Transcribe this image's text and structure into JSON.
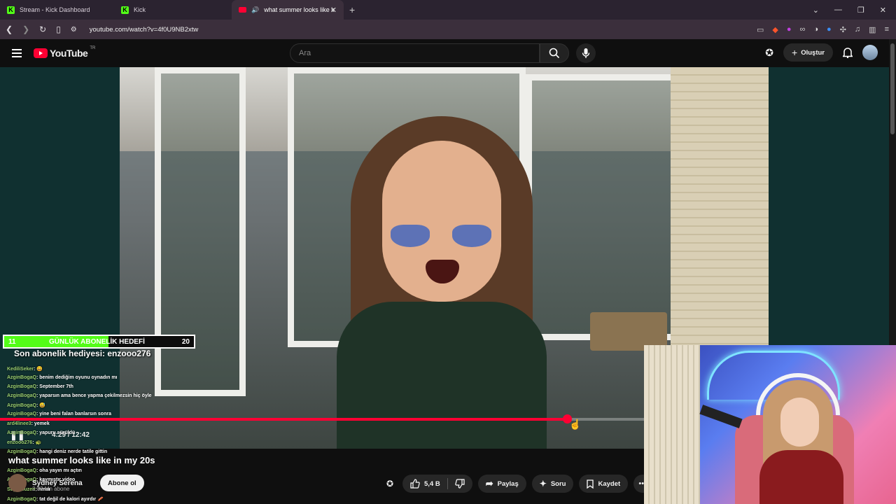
{
  "browser": {
    "tabs": [
      {
        "title": "Stream - Kick Dashboard",
        "icon": "kick-icon",
        "active": false
      },
      {
        "title": "Kick",
        "icon": "kick-icon",
        "active": false
      },
      {
        "title": "what summer looks like in my",
        "icon": "youtube-icon",
        "active": true
      }
    ],
    "new_tab": "+",
    "url": "youtube.com/watch?v=4f0U9NB2xtw",
    "window_controls": [
      "⌄",
      "—",
      "❐",
      "✕"
    ]
  },
  "youtube": {
    "logo_text": "YouTube",
    "region": "TR",
    "search_placeholder": "Ara",
    "create_label": "Oluştur",
    "video_title": "what summer looks like in my 20s",
    "channel_name": "Sydney Serena",
    "channel_subs": "2,82 Mn abone",
    "subscribe_label": "Abone ol",
    "like_count": "5,4 B",
    "share_label": "Paylaş",
    "ask_label": "Soru",
    "save_label": "Kaydet",
    "progress": 0.88,
    "accent": "#ff0033"
  },
  "overlay": {
    "goal_current": "11",
    "goal_label": "GÜNLÜK ABONELİK HEDEFİ",
    "goal_target": "20",
    "goal_fraction": 0.55,
    "last_gift": "Son abonelik hediyesi: enzooo276",
    "goal_color": "#53fc18",
    "chat": [
      {
        "user": "KediliSeker",
        "msg": ": 😄"
      },
      {
        "user": "AzginBogaQ",
        "msg": ": benim dediğim oyunu oynadın mı"
      },
      {
        "user": "AzginBogaQ",
        "msg": ": September 7th"
      },
      {
        "user": "AzginBogaQ",
        "msg": ": yaparsın ama bence yapma çekilmezsin hiç öyle"
      },
      {
        "user": "AzginBogaQ",
        "msg": ": 😅"
      },
      {
        "user": "AzginBogaQ",
        "msg": ": yine beni falan banlarsın sonra"
      },
      {
        "user": "ard4linee3",
        "msg": ": yemek"
      },
      {
        "user": "AzginBogaQ",
        "msg": ": yapuru sürüldü"
      },
      {
        "user": "enzooo276",
        "msg": ": 🐢"
      },
      {
        "user": "AzginBogaQ",
        "msg": ": hangi deniz nerde tatile gittin"
      },
      {
        "user": "AzginBogaQ",
        "msg": ": oha yayın mı açtın"
      },
      {
        "user": "AzginBogaQ",
        "msg": ": kaymıştır video"
      },
      {
        "user": "SuperSuzen",
        "msg": ": hmm"
      },
      {
        "user": "AzginBogaQ",
        "msg": ": tat değil de kalori ayırdır 🥓"
      }
    ],
    "time": "4:29 / 12:42"
  }
}
